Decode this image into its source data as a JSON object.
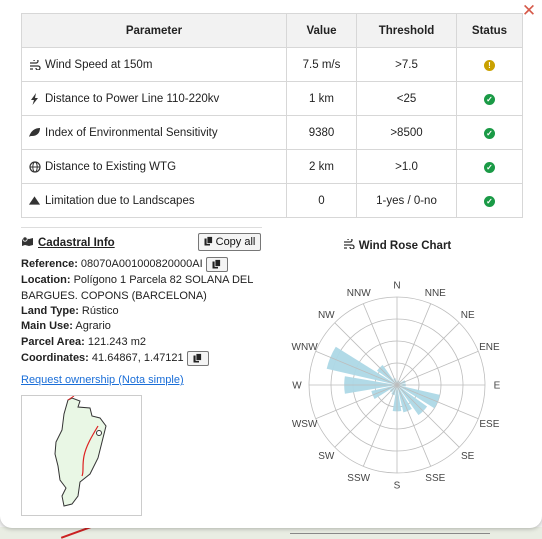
{
  "table": {
    "headers": [
      "Parameter",
      "Value",
      "Threshold",
      "Status"
    ],
    "rows": [
      {
        "icon": "wind-icon",
        "parameter": "Wind Speed at 150m",
        "value": "7.5 m/s",
        "threshold": ">7.5",
        "status": "warning",
        "status_glyph": "!"
      },
      {
        "icon": "bolt-icon",
        "parameter": "Distance to Power Line 110-220kv",
        "value": "1 km",
        "threshold": "<25",
        "status": "ok",
        "status_glyph": "✓"
      },
      {
        "icon": "leaf-icon",
        "parameter": "Index of Environmental Sensitivity",
        "value": "9380",
        "threshold": ">8500",
        "status": "ok",
        "status_glyph": "✓"
      },
      {
        "icon": "globe-icon",
        "parameter": "Distance to Existing WTG",
        "value": "2 km",
        "threshold": ">1.0",
        "status": "ok",
        "status_glyph": "✓"
      },
      {
        "icon": "mountain-icon",
        "parameter": "Limitation due to Landscapes",
        "value": "0",
        "threshold": "1-yes / 0-no",
        "status": "ok",
        "status_glyph": "✓"
      }
    ]
  },
  "cadastral": {
    "title": "Cadastral Info",
    "copy_all_label": "Copy all",
    "reference_label": "Reference:",
    "reference_value": "08070A001000820000AI",
    "location_label": "Location:",
    "location_value": "Polígono 1 Parcela 82 SOLANA DEL BARGUES. COPONS (BARCELONA)",
    "land_type_label": "Land Type:",
    "land_type_value": "Rústico",
    "main_use_label": "Main Use:",
    "main_use_value": "Agrario",
    "parcel_area_label": "Parcel Area:",
    "parcel_area_value": "121.243 m2",
    "coordinates_label": "Coordinates:",
    "coordinates_value": "41.64867, 1.47121",
    "request_link": "Request ownership (Nota simple)"
  },
  "rose": {
    "title": "Wind Rose Chart",
    "directions": [
      "N",
      "NNE",
      "NE",
      "ENE",
      "E",
      "ESE",
      "SE",
      "SSE",
      "S",
      "SSW",
      "SW",
      "WSW",
      "W",
      "WNW",
      "NW",
      "NNW"
    ]
  },
  "chart_data": {
    "type": "polar-bar",
    "title": "Wind Rose Chart",
    "categories": [
      "N",
      "NNE",
      "NE",
      "ENE",
      "E",
      "ESE",
      "SE",
      "SSE",
      "S",
      "SSW",
      "SW",
      "WSW",
      "W",
      "WNW",
      "NW",
      "NNW"
    ],
    "values": [
      0.05,
      0.05,
      0.05,
      0.1,
      0.1,
      0.5,
      0.42,
      0.32,
      0.3,
      0.12,
      0.1,
      0.3,
      0.6,
      0.82,
      0.28,
      0.08
    ],
    "rmax": 1,
    "grid": true,
    "colors": {
      "bar": "#add8e6",
      "grid": "#bdbdbd"
    }
  }
}
